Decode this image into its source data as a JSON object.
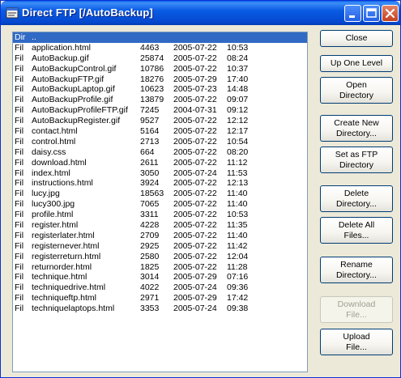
{
  "window": {
    "title": "Direct FTP [/AutoBackup]"
  },
  "file_list": [
    {
      "type": "Dir",
      "name": "..",
      "size": "",
      "date": "",
      "time": "",
      "selected": true
    },
    {
      "type": "Fil",
      "name": "application.html",
      "size": "4463",
      "date": "2005-07-22",
      "time": "10:53"
    },
    {
      "type": "Fil",
      "name": "AutoBackup.gif",
      "size": "25874",
      "date": "2005-07-22",
      "time": "08:24"
    },
    {
      "type": "Fil",
      "name": "AutoBackupControl.gif",
      "size": "10786",
      "date": "2005-07-22",
      "time": "10:37"
    },
    {
      "type": "Fil",
      "name": "AutoBackupFTP.gif",
      "size": "18276",
      "date": "2005-07-29",
      "time": "17:40"
    },
    {
      "type": "Fil",
      "name": "AutoBackupLaptop.gif",
      "size": "10623",
      "date": "2005-07-23",
      "time": "14:48"
    },
    {
      "type": "Fil",
      "name": "AutoBackupProfile.gif",
      "size": "13879",
      "date": "2005-07-22",
      "time": "09:07"
    },
    {
      "type": "Fil",
      "name": "AutoBackupProfileFTP.gif",
      "size": "7245",
      "date": "2004-07-31",
      "time": "09:12"
    },
    {
      "type": "Fil",
      "name": "AutoBackupRegister.gif",
      "size": "9527",
      "date": "2005-07-22",
      "time": "12:12"
    },
    {
      "type": "Fil",
      "name": "contact.html",
      "size": "5164",
      "date": "2005-07-22",
      "time": "12:17"
    },
    {
      "type": "Fil",
      "name": "control.html",
      "size": "2713",
      "date": "2005-07-22",
      "time": "10:54"
    },
    {
      "type": "Fil",
      "name": "daisy.css",
      "size": "664",
      "date": "2005-07-22",
      "time": "08:20"
    },
    {
      "type": "Fil",
      "name": "download.html",
      "size": "2611",
      "date": "2005-07-22",
      "time": "11:12"
    },
    {
      "type": "Fil",
      "name": "index.html",
      "size": "3050",
      "date": "2005-07-24",
      "time": "11:53"
    },
    {
      "type": "Fil",
      "name": "instructions.html",
      "size": "3924",
      "date": "2005-07-22",
      "time": "12:13"
    },
    {
      "type": "Fil",
      "name": "lucy.jpg",
      "size": "18563",
      "date": "2005-07-22",
      "time": "11:40"
    },
    {
      "type": "Fil",
      "name": "lucy300.jpg",
      "size": "7065",
      "date": "2005-07-22",
      "time": "11:40"
    },
    {
      "type": "Fil",
      "name": "profile.html",
      "size": "3311",
      "date": "2005-07-22",
      "time": "10:53"
    },
    {
      "type": "Fil",
      "name": "register.html",
      "size": "4228",
      "date": "2005-07-22",
      "time": "11:35"
    },
    {
      "type": "Fil",
      "name": "registerlater.html",
      "size": "2709",
      "date": "2005-07-22",
      "time": "11:40"
    },
    {
      "type": "Fil",
      "name": "registernever.html",
      "size": "2925",
      "date": "2005-07-22",
      "time": "11:42"
    },
    {
      "type": "Fil",
      "name": "registerreturn.html",
      "size": "2580",
      "date": "2005-07-22",
      "time": "12:04"
    },
    {
      "type": "Fil",
      "name": "returnorder.html",
      "size": "1825",
      "date": "2005-07-22",
      "time": "11:28"
    },
    {
      "type": "Fil",
      "name": "technique.html",
      "size": "3014",
      "date": "2005-07-29",
      "time": "07:16"
    },
    {
      "type": "Fil",
      "name": "techniquedrive.html",
      "size": "4022",
      "date": "2005-07-24",
      "time": "09:36"
    },
    {
      "type": "Fil",
      "name": "techniqueftp.html",
      "size": "2971",
      "date": "2005-07-29",
      "time": "17:42"
    },
    {
      "type": "Fil",
      "name": "techniquelaptops.html",
      "size": "3353",
      "date": "2005-07-24",
      "time": "09:38"
    }
  ],
  "buttons": {
    "close": "Close",
    "up_one_level": "Up One Level",
    "open_directory": "Open\nDirectory",
    "create_directory": "Create New\nDirectory...",
    "set_ftp_directory": "Set as FTP\nDirectory",
    "delete_directory": "Delete\nDirectory...",
    "delete_all_files": "Delete All\nFiles...",
    "rename_directory": "Rename\nDirectory...",
    "download_file": "Download\nFile...",
    "upload_file": "Upload\nFile..."
  },
  "colors": {
    "selection": "#316ac5",
    "titlebar": "#0a5ce4"
  }
}
